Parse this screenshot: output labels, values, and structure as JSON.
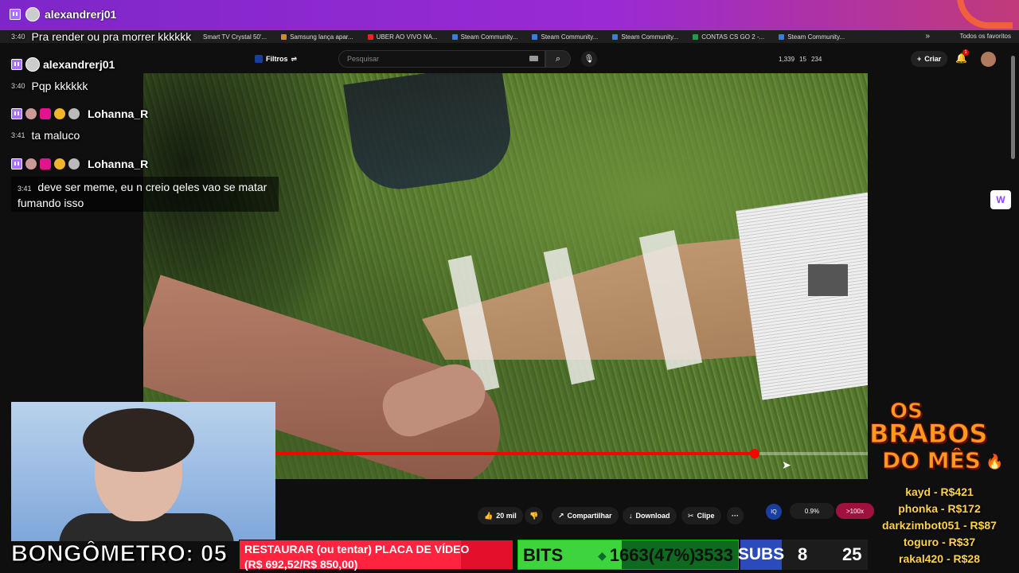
{
  "topbar": {
    "username": "alexandrerj01"
  },
  "bookmarks": {
    "items": [
      "Smart TV Crystal 50'...",
      "Samsung lança apar...",
      "UBER AO VIVO NA...",
      "Steam Community...",
      "Steam Community...",
      "Steam Community...",
      "CONTAS CS GO 2 -...",
      "Steam Community..."
    ],
    "more": "»",
    "favorites": "Todos os favoritos"
  },
  "youtube": {
    "filters_label": "Filtros",
    "search_placeholder": "Pesquisar",
    "stats": {
      "a": "1,339",
      "b": "15",
      "c": "234"
    },
    "create_label": "Criar",
    "notif_count": "1",
    "progress_fraction": 0.81
  },
  "actions": {
    "like": "20 mil",
    "share": "Compartilhar",
    "download": "Download",
    "clip": "Clipe",
    "more": "···",
    "iq": "IQ",
    "pct": "0.9%",
    "speed": ">100x"
  },
  "chat": [
    {
      "user": "alexandrerj01",
      "time": "3:40",
      "text": "Pra render ou pra morrer kkkkkk"
    },
    {
      "user": "alexandrerj01",
      "time": "3:40",
      "text": "Pqp kkkkkk"
    },
    {
      "user": "Lohanna_R",
      "time": "3:41",
      "text": "ta maluco"
    },
    {
      "user": "Lohanna_R",
      "time": "3:41",
      "text": "deve ser meme, eu n creio qeles vao se matar fumando isso"
    }
  ],
  "overlay": {
    "bongometro": "BONGÔMETRO: 05",
    "goal_line1": "RESTAURAR (ou tentar) PLACA DE VÍDEO",
    "goal_line2": "(R$ 692,52/R$ 850,00)",
    "goal_fraction": 0.81,
    "bits_label": "BITS",
    "bits_value": "1663(47%)",
    "bits_goal": "3533",
    "bits_fraction": 0.47,
    "subs_label": "SUBS",
    "subs_a": "8",
    "subs_b": "25"
  },
  "brabos": {
    "line1": "OS",
    "line2": "BRABOS",
    "line3": "DO MÊS",
    "donors": [
      "kayd - R$421",
      "phonka - R$172",
      "darkzimbot051 - R$87",
      "toguro - R$37",
      "rakal420 - R$28"
    ]
  },
  "colors": {
    "twitch_purple": "#9146ff",
    "yt_red": "#ff0000",
    "bits_green": "#3dd43d",
    "subs_blue": "#2b4bbd"
  }
}
